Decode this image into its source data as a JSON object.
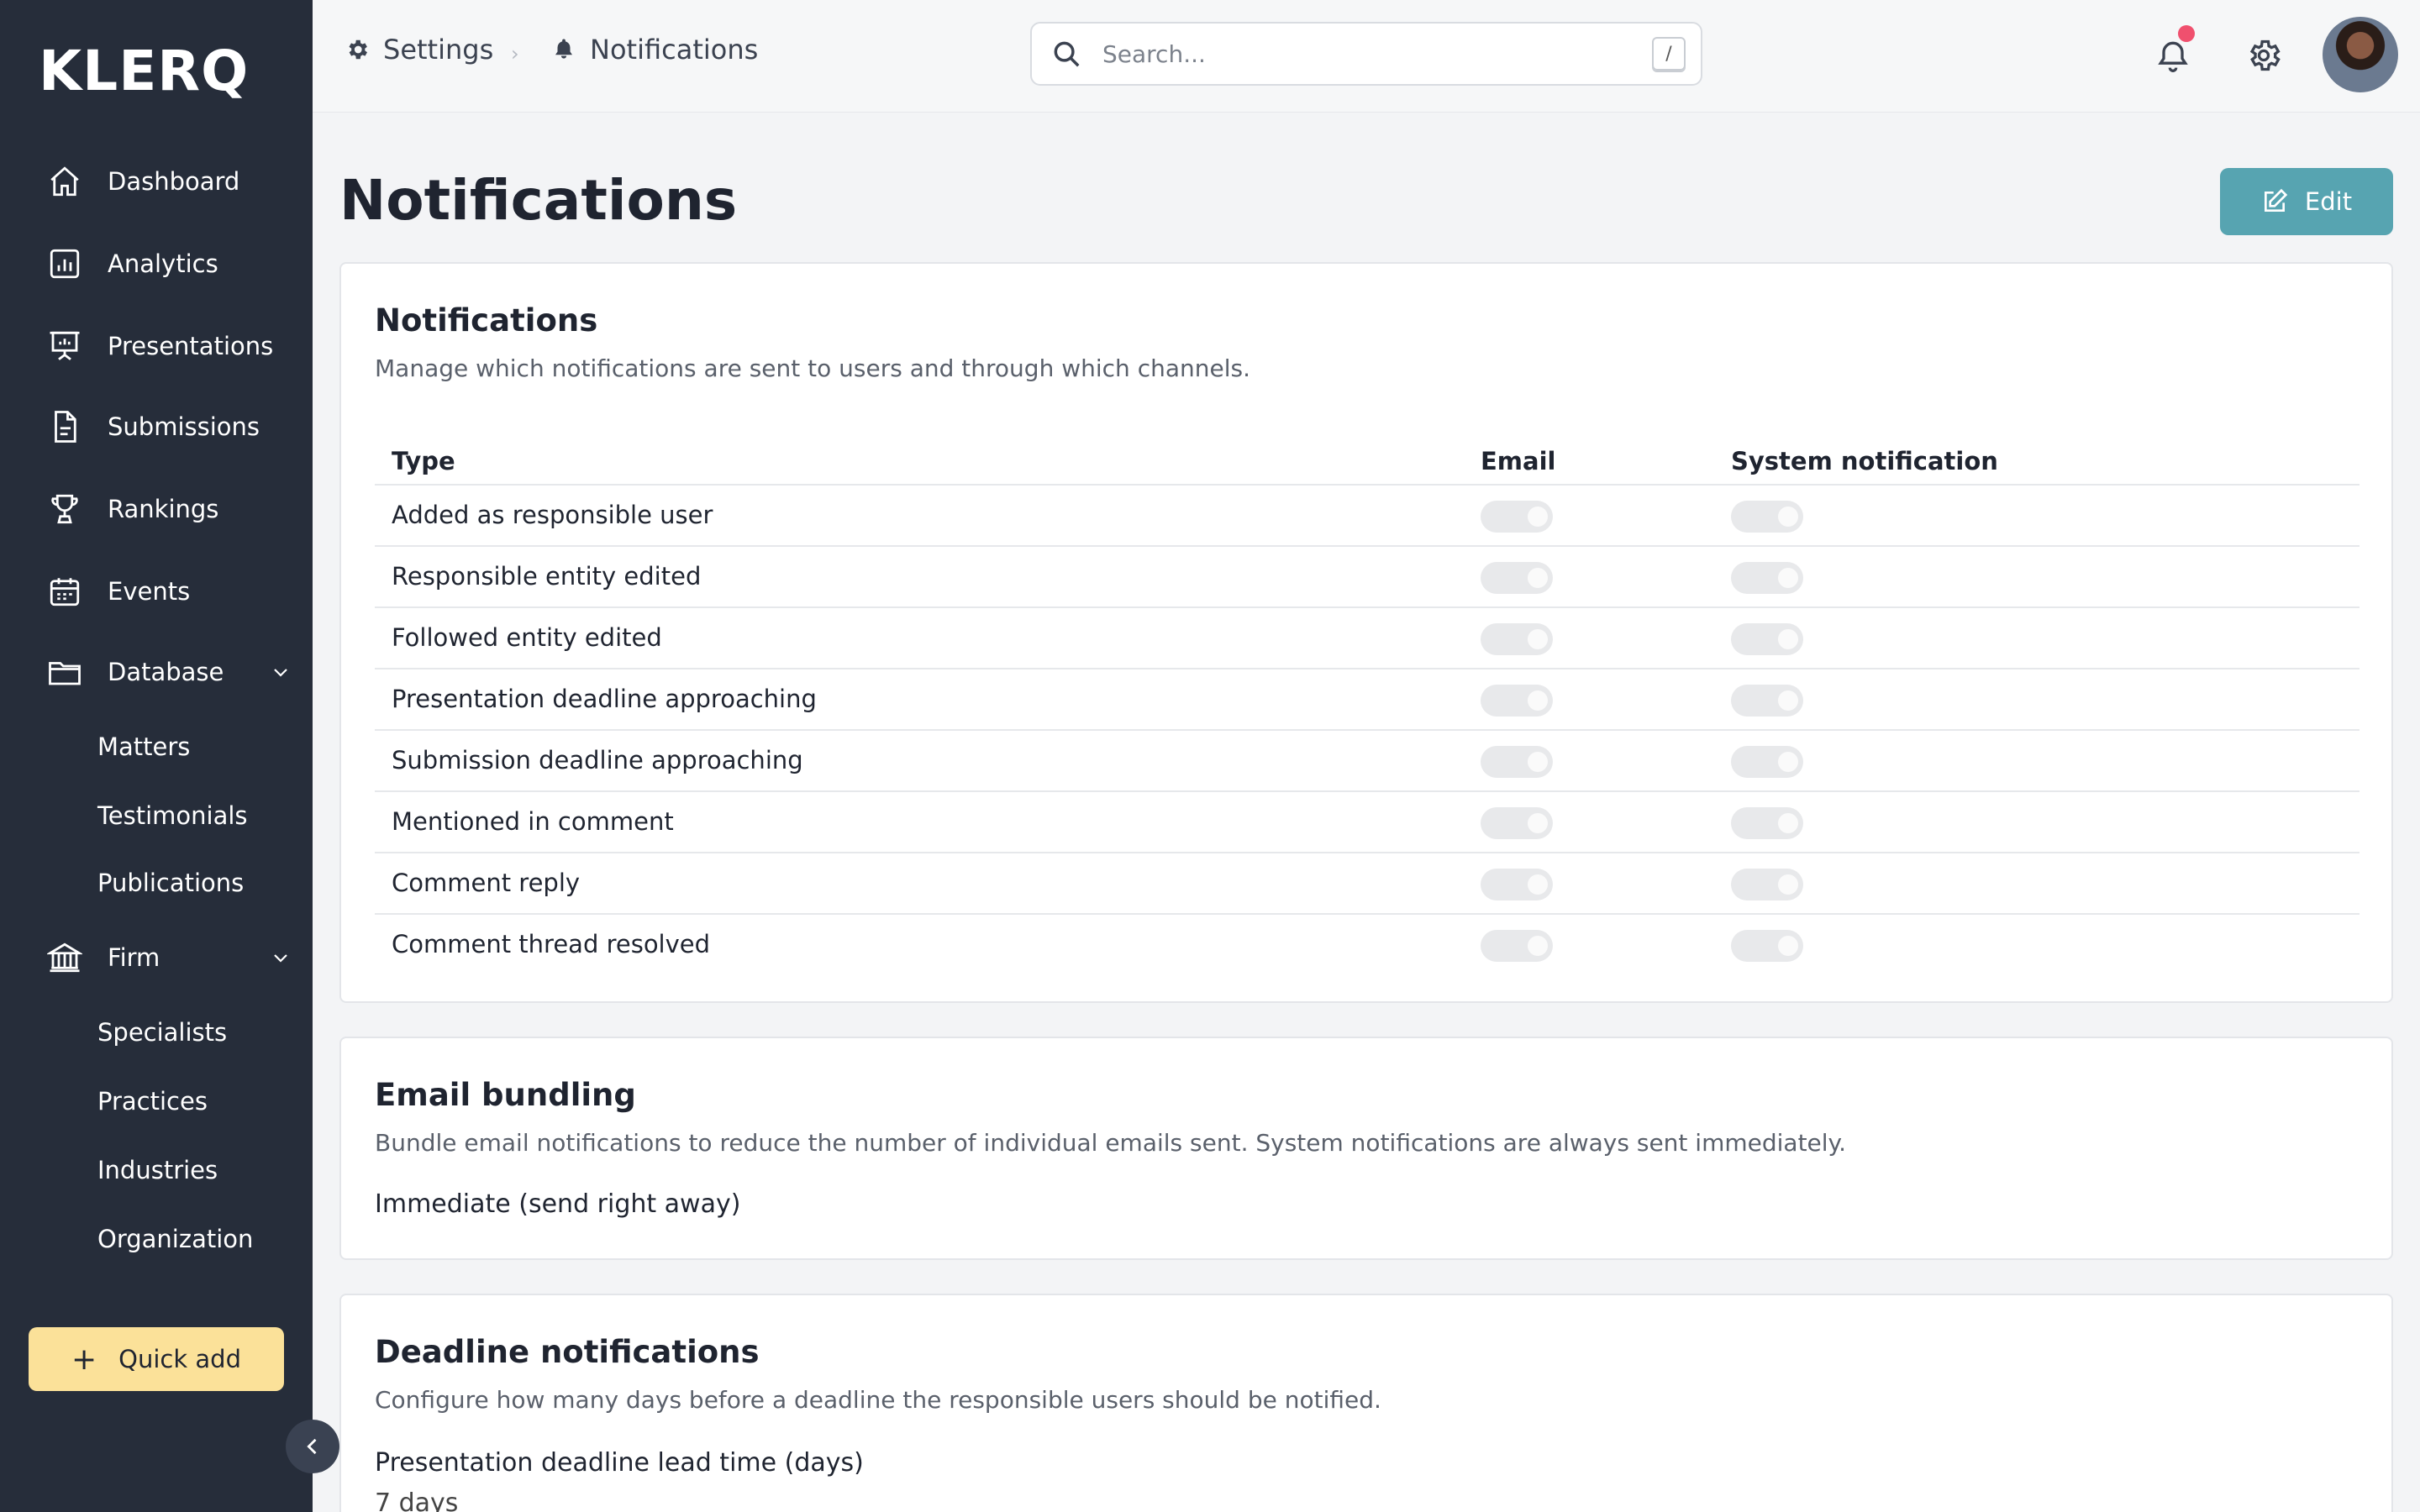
{
  "app": {
    "logo": "KLERQ"
  },
  "sidebar": {
    "items": [
      {
        "label": "Dashboard",
        "icon": "home-icon"
      },
      {
        "label": "Analytics",
        "icon": "analytics-icon"
      },
      {
        "label": "Presentations",
        "icon": "presentation-icon"
      },
      {
        "label": "Submissions",
        "icon": "document-icon"
      },
      {
        "label": "Rankings",
        "icon": "trophy-icon"
      },
      {
        "label": "Events",
        "icon": "calendar-icon"
      },
      {
        "label": "Database",
        "icon": "folder-icon"
      },
      {
        "label": "Firm",
        "icon": "bank-icon"
      }
    ],
    "database_sub": [
      "Matters",
      "Testimonials",
      "Publications"
    ],
    "firm_sub": [
      "Specialists",
      "Practices",
      "Industries",
      "Organization"
    ],
    "quick_add": "Quick add"
  },
  "topbar": {
    "breadcrumb": [
      "Settings",
      "Notifications"
    ],
    "search_placeholder": "Search...",
    "search_shortcut": "/"
  },
  "page": {
    "title": "Notifications",
    "edit_label": "Edit"
  },
  "notifications": {
    "title": "Notifications",
    "description": "Manage which notifications are sent to users and through which channels.",
    "columns": [
      "Type",
      "Email",
      "System notification"
    ],
    "rows": [
      {
        "type": "Added as responsible user",
        "email": false,
        "system": false
      },
      {
        "type": "Responsible entity edited",
        "email": false,
        "system": false
      },
      {
        "type": "Followed entity edited",
        "email": false,
        "system": false
      },
      {
        "type": "Presentation deadline approaching",
        "email": false,
        "system": false
      },
      {
        "type": "Submission deadline approaching",
        "email": false,
        "system": false
      },
      {
        "type": "Mentioned in comment",
        "email": false,
        "system": false
      },
      {
        "type": "Comment reply",
        "email": false,
        "system": false
      },
      {
        "type": "Comment thread resolved",
        "email": false,
        "system": false
      }
    ]
  },
  "email_bundling": {
    "title": "Email bundling",
    "description": "Bundle email notifications to reduce the number of individual emails sent. System notifications are always sent immediately.",
    "value": "Immediate (send right away)"
  },
  "deadline": {
    "title": "Deadline notifications",
    "description": "Configure how many days before a deadline the responsible users should be notified.",
    "field_label": "Presentation deadline lead time (days)",
    "field_value": "7 days"
  }
}
